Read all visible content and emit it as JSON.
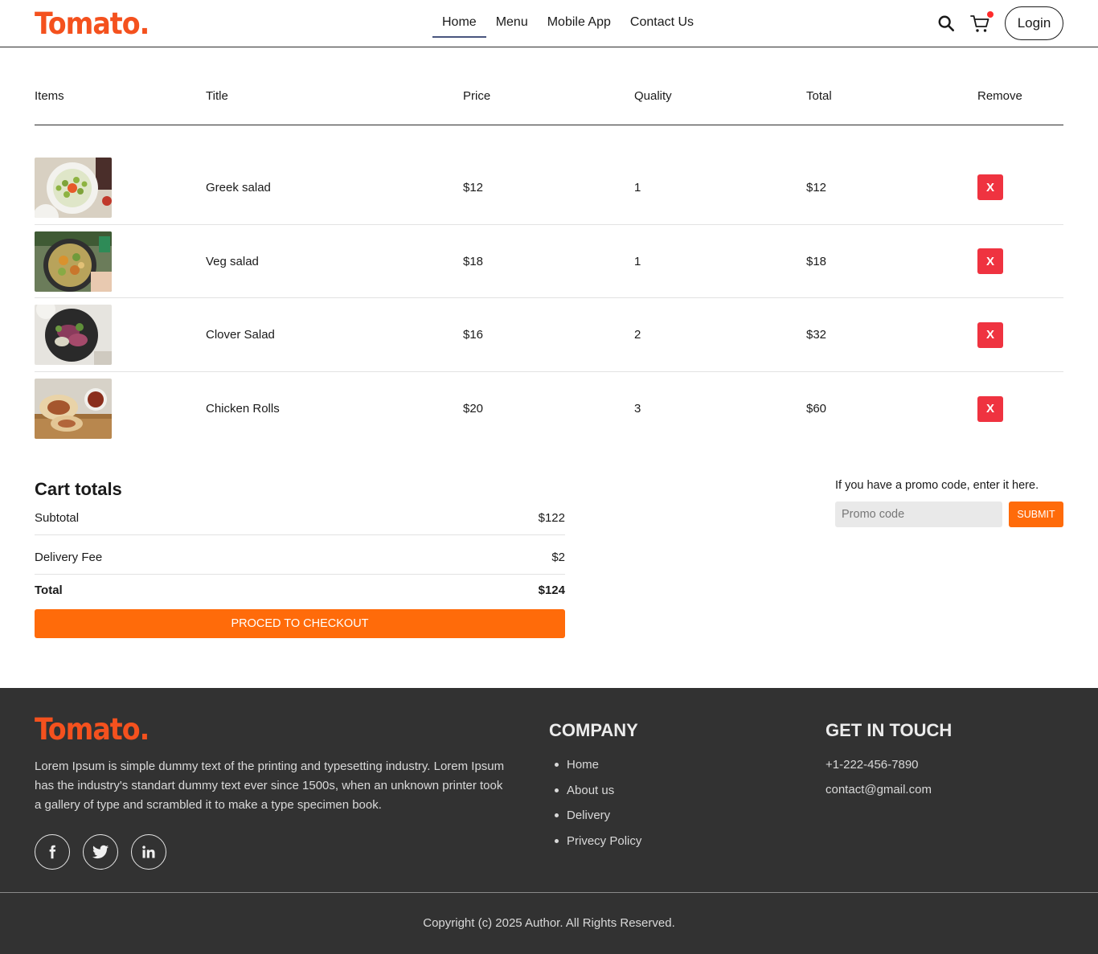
{
  "nav": {
    "logo": "Tomato.",
    "links": [
      "Home",
      "Menu",
      "Mobile App",
      "Contact Us"
    ],
    "login_label": "Login",
    "accent_color": "#ff6b0a"
  },
  "table": {
    "headers": [
      "Items",
      "Title",
      "Price",
      "Quality",
      "Total",
      "Remove"
    ],
    "rows": [
      {
        "title": "Greek salad",
        "price": "$12",
        "quantity": "1",
        "total": "$12",
        "remove": "X"
      },
      {
        "title": "Veg salad",
        "price": "$18",
        "quantity": "1",
        "total": "$18",
        "remove": "X"
      },
      {
        "title": "Clover Salad",
        "price": "$16",
        "quantity": "2",
        "total": "$32",
        "remove": "X"
      },
      {
        "title": "Chicken Rolls",
        "price": "$20",
        "quantity": "3",
        "total": "$60",
        "remove": "X"
      }
    ]
  },
  "totals": {
    "title": "Cart totals",
    "subtotal_label": "Subtotal",
    "subtotal_value": "$122",
    "delivery_label": "Delivery Fee",
    "delivery_value": "$2",
    "total_label": "Total",
    "total_value": "$124",
    "checkout_label": "PROCED TO CHECKOUT"
  },
  "promo": {
    "text": "If you have a promo code, enter it here.",
    "placeholder": "Promo code",
    "submit_label": "SUBMIT"
  },
  "footer": {
    "logo": "Tomato.",
    "description": "Lorem Ipsum is simple dummy text of the printing and typesetting industry. Lorem Ipsum has the industry's standart dummy text ever since 1500s, when an unknown printer took a gallery of type and scrambled it to make a type specimen book.",
    "socials": [
      "facebook-icon",
      "twitter-icon",
      "linkedin-icon"
    ],
    "company_title": "COMPANY",
    "company_links": [
      "Home",
      "About us",
      "Delivery",
      "Privecy Policy"
    ],
    "touch_title": "GET IN TOUCH",
    "phone": "+1-222-456-7890",
    "email": "contact@gmail.com",
    "copyright": "Copyright (c) 2025 Author. All Rights Reserved."
  }
}
